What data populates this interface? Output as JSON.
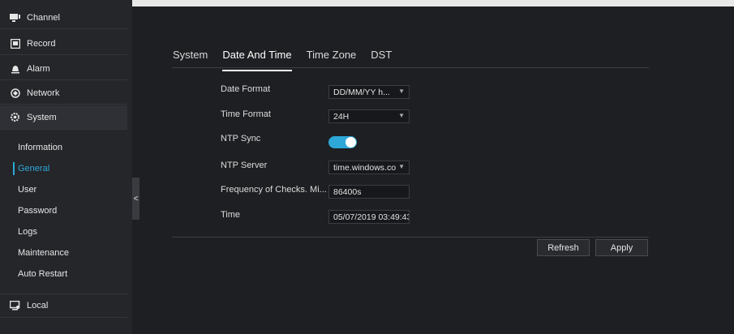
{
  "sidebar": {
    "items": [
      {
        "label": "Channel",
        "icon": "monitor-icon"
      },
      {
        "label": "Record",
        "icon": "record-icon"
      },
      {
        "label": "Alarm",
        "icon": "alarm-icon"
      },
      {
        "label": "Network",
        "icon": "network-icon"
      },
      {
        "label": "System",
        "icon": "gear-icon"
      }
    ],
    "sub_items": [
      "Information",
      "General",
      "User",
      "Password",
      "Logs",
      "Maintenance",
      "Auto Restart"
    ],
    "local": {
      "label": "Local",
      "icon": "local-icon"
    },
    "collapse_glyph": "<"
  },
  "tabs": [
    "System",
    "Date And Time",
    "Time Zone",
    "DST"
  ],
  "form": {
    "date_format": {
      "label": "Date Format",
      "value": "DD/MM/YY h..."
    },
    "time_format": {
      "label": "Time Format",
      "value": "24H"
    },
    "ntp_sync": {
      "label": "NTP Sync",
      "enabled": true
    },
    "ntp_server": {
      "label": "NTP Server",
      "value": "time.windows.co"
    },
    "frequency": {
      "label": "Frequency of Checks. Mi...",
      "value": "86400s"
    },
    "time": {
      "label": "Time",
      "value": "05/07/2019 03:49:43"
    }
  },
  "buttons": {
    "refresh": "Refresh",
    "apply": "Apply"
  },
  "colors": {
    "accent": "#2da8d8",
    "background": "#1e1f22",
    "sidebar": "#25262a"
  }
}
